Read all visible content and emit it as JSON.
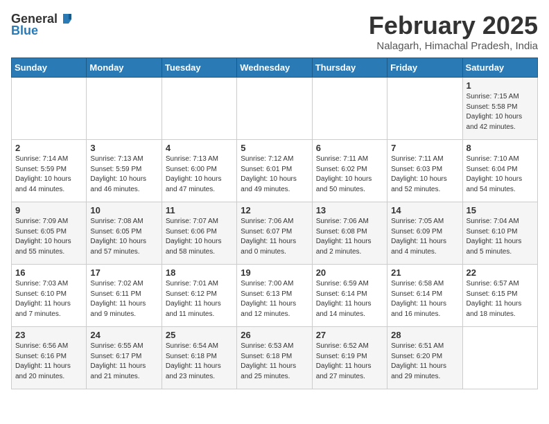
{
  "header": {
    "logo_general": "General",
    "logo_blue": "Blue",
    "title": "February 2025",
    "subtitle": "Nalagarh, Himachal Pradesh, India"
  },
  "weekdays": [
    "Sunday",
    "Monday",
    "Tuesday",
    "Wednesday",
    "Thursday",
    "Friday",
    "Saturday"
  ],
  "weeks": [
    [
      {
        "day": "",
        "info": ""
      },
      {
        "day": "",
        "info": ""
      },
      {
        "day": "",
        "info": ""
      },
      {
        "day": "",
        "info": ""
      },
      {
        "day": "",
        "info": ""
      },
      {
        "day": "",
        "info": ""
      },
      {
        "day": "1",
        "info": "Sunrise: 7:15 AM\nSunset: 5:58 PM\nDaylight: 10 hours\nand 42 minutes."
      }
    ],
    [
      {
        "day": "2",
        "info": "Sunrise: 7:14 AM\nSunset: 5:59 PM\nDaylight: 10 hours\nand 44 minutes."
      },
      {
        "day": "3",
        "info": "Sunrise: 7:13 AM\nSunset: 5:59 PM\nDaylight: 10 hours\nand 46 minutes."
      },
      {
        "day": "4",
        "info": "Sunrise: 7:13 AM\nSunset: 6:00 PM\nDaylight: 10 hours\nand 47 minutes."
      },
      {
        "day": "5",
        "info": "Sunrise: 7:12 AM\nSunset: 6:01 PM\nDaylight: 10 hours\nand 49 minutes."
      },
      {
        "day": "6",
        "info": "Sunrise: 7:11 AM\nSunset: 6:02 PM\nDaylight: 10 hours\nand 50 minutes."
      },
      {
        "day": "7",
        "info": "Sunrise: 7:11 AM\nSunset: 6:03 PM\nDaylight: 10 hours\nand 52 minutes."
      },
      {
        "day": "8",
        "info": "Sunrise: 7:10 AM\nSunset: 6:04 PM\nDaylight: 10 hours\nand 54 minutes."
      }
    ],
    [
      {
        "day": "9",
        "info": "Sunrise: 7:09 AM\nSunset: 6:05 PM\nDaylight: 10 hours\nand 55 minutes."
      },
      {
        "day": "10",
        "info": "Sunrise: 7:08 AM\nSunset: 6:05 PM\nDaylight: 10 hours\nand 57 minutes."
      },
      {
        "day": "11",
        "info": "Sunrise: 7:07 AM\nSunset: 6:06 PM\nDaylight: 10 hours\nand 58 minutes."
      },
      {
        "day": "12",
        "info": "Sunrise: 7:06 AM\nSunset: 6:07 PM\nDaylight: 11 hours\nand 0 minutes."
      },
      {
        "day": "13",
        "info": "Sunrise: 7:06 AM\nSunset: 6:08 PM\nDaylight: 11 hours\nand 2 minutes."
      },
      {
        "day": "14",
        "info": "Sunrise: 7:05 AM\nSunset: 6:09 PM\nDaylight: 11 hours\nand 4 minutes."
      },
      {
        "day": "15",
        "info": "Sunrise: 7:04 AM\nSunset: 6:10 PM\nDaylight: 11 hours\nand 5 minutes."
      }
    ],
    [
      {
        "day": "16",
        "info": "Sunrise: 7:03 AM\nSunset: 6:10 PM\nDaylight: 11 hours\nand 7 minutes."
      },
      {
        "day": "17",
        "info": "Sunrise: 7:02 AM\nSunset: 6:11 PM\nDaylight: 11 hours\nand 9 minutes."
      },
      {
        "day": "18",
        "info": "Sunrise: 7:01 AM\nSunset: 6:12 PM\nDaylight: 11 hours\nand 11 minutes."
      },
      {
        "day": "19",
        "info": "Sunrise: 7:00 AM\nSunset: 6:13 PM\nDaylight: 11 hours\nand 12 minutes."
      },
      {
        "day": "20",
        "info": "Sunrise: 6:59 AM\nSunset: 6:14 PM\nDaylight: 11 hours\nand 14 minutes."
      },
      {
        "day": "21",
        "info": "Sunrise: 6:58 AM\nSunset: 6:14 PM\nDaylight: 11 hours\nand 16 minutes."
      },
      {
        "day": "22",
        "info": "Sunrise: 6:57 AM\nSunset: 6:15 PM\nDaylight: 11 hours\nand 18 minutes."
      }
    ],
    [
      {
        "day": "23",
        "info": "Sunrise: 6:56 AM\nSunset: 6:16 PM\nDaylight: 11 hours\nand 20 minutes."
      },
      {
        "day": "24",
        "info": "Sunrise: 6:55 AM\nSunset: 6:17 PM\nDaylight: 11 hours\nand 21 minutes."
      },
      {
        "day": "25",
        "info": "Sunrise: 6:54 AM\nSunset: 6:18 PM\nDaylight: 11 hours\nand 23 minutes."
      },
      {
        "day": "26",
        "info": "Sunrise: 6:53 AM\nSunset: 6:18 PM\nDaylight: 11 hours\nand 25 minutes."
      },
      {
        "day": "27",
        "info": "Sunrise: 6:52 AM\nSunset: 6:19 PM\nDaylight: 11 hours\nand 27 minutes."
      },
      {
        "day": "28",
        "info": "Sunrise: 6:51 AM\nSunset: 6:20 PM\nDaylight: 11 hours\nand 29 minutes."
      },
      {
        "day": "",
        "info": ""
      }
    ]
  ]
}
